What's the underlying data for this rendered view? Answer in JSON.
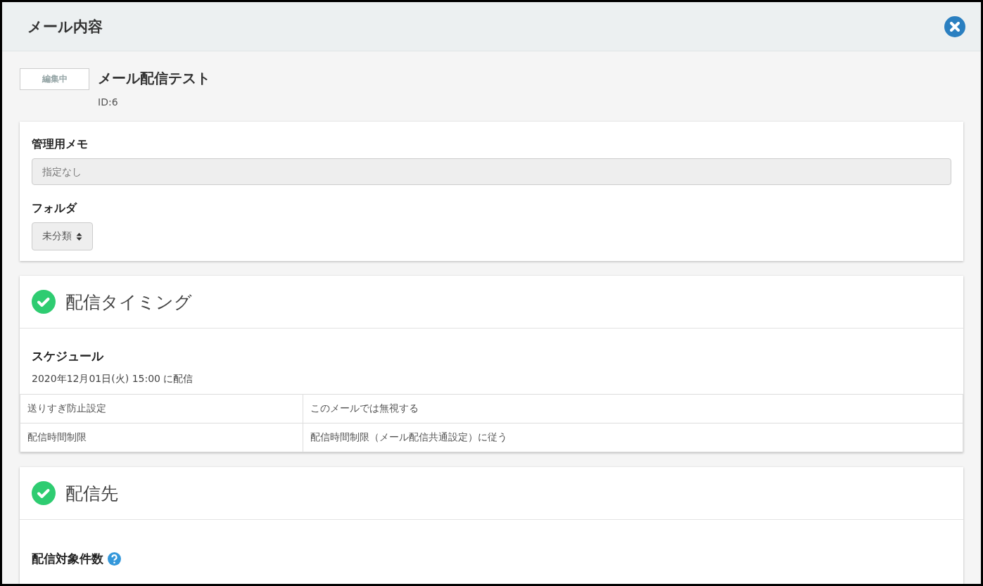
{
  "dialog": {
    "title": "メール内容"
  },
  "mail": {
    "status": "編集中",
    "name": "メール配信テスト",
    "id": "ID:6"
  },
  "settings": {
    "memo_label": "管理用メモ",
    "memo_placeholder": "指定なし",
    "folder_label": "フォルダ",
    "folder_value": "未分類"
  },
  "sections": [
    {
      "title": "配信タイミング",
      "completed": true,
      "subtitle": "スケジュール",
      "text": "2020年12月01日(火) 15:00 に配信",
      "rows": [
        [
          "送りすぎ防止設定",
          "このメールでは無視する"
        ],
        [
          "配信時間制限",
          "配信時間制限（メール配信共通設定）に従う"
        ]
      ]
    },
    {
      "title": "配信先",
      "completed": true,
      "subtitle": "配信対象件数",
      "help": true
    }
  ]
}
